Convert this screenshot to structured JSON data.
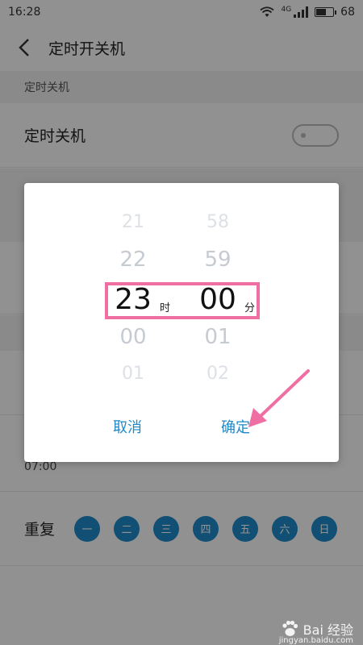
{
  "status_bar": {
    "time": "16:28",
    "network": "4G",
    "battery": "68",
    "battery_level": 0.68
  },
  "header": {
    "title": "定时开关机"
  },
  "section": {
    "title": "定时关机"
  },
  "rows": {
    "scheduled_off_label": "定时关机",
    "time_value": "07:00",
    "repeat_label": "重复"
  },
  "days": [
    "一",
    "二",
    "三",
    "四",
    "五",
    "六",
    "日"
  ],
  "picker": {
    "hours": [
      "21",
      "22",
      "23",
      "00",
      "01"
    ],
    "minutes": [
      "58",
      "59",
      "00",
      "01",
      "02"
    ],
    "hour_unit": "时",
    "minute_unit": "分"
  },
  "dialog": {
    "cancel_label": "取消",
    "ok_label": "确定"
  },
  "watermark": {
    "brand": "Bai 经验",
    "url": "jingyan.baidu.com"
  },
  "colors": {
    "accent": "#1e88c9",
    "highlight": "#ef6fa3"
  }
}
